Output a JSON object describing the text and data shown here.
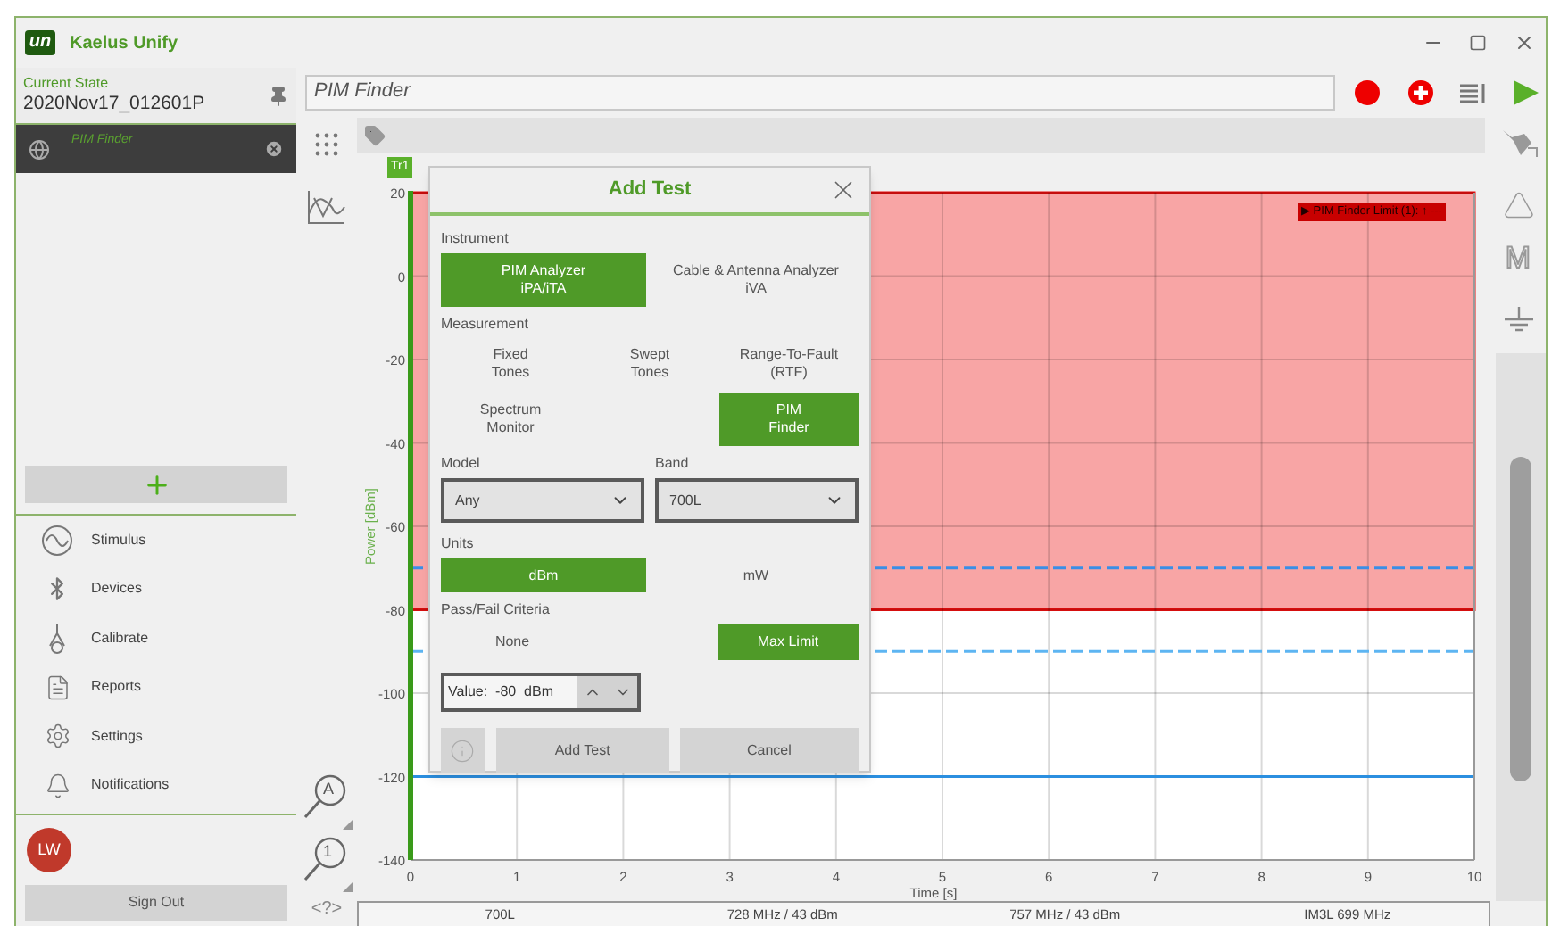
{
  "window": {
    "logo": "un",
    "title": "Kaelus Unify"
  },
  "sidebar": {
    "current_state_label": "Current State",
    "current_state": "2020Nov17_012601P",
    "tests": [
      {
        "label": "PIM Finder",
        "selected": true
      }
    ],
    "nav": [
      {
        "label": "Stimulus"
      },
      {
        "label": "Devices"
      },
      {
        "label": "Calibrate"
      },
      {
        "label": "Reports"
      },
      {
        "label": "Settings"
      },
      {
        "label": "Notifications"
      }
    ],
    "user": {
      "initials": "LW"
    },
    "sign_out": "Sign Out"
  },
  "toolbar": {
    "test_name": "PIM Finder"
  },
  "left_tools": {
    "zoom_auto": "A",
    "zoom_one": "1",
    "help": "<?>"
  },
  "right_toolbar": {
    "marker_text": "M"
  },
  "trace": {
    "label": "Tr1"
  },
  "chart_data": {
    "type": "line",
    "xlabel": "Time [s]",
    "ylabel": "Power [dBm]",
    "xlim": [
      0,
      10
    ],
    "ylim": [
      -140,
      20
    ],
    "xticks": [
      0,
      1,
      2,
      3,
      4,
      5,
      6,
      7,
      8,
      9,
      10
    ],
    "yticks": [
      20,
      0,
      -20,
      -40,
      -60,
      -80,
      -100,
      -120,
      -140
    ],
    "x": [
      0,
      10
    ],
    "series": [
      {
        "color": "#3a8ee6",
        "line_style": "dashed",
        "values": [
          -70,
          -70
        ]
      },
      {
        "color": "#5db5f2",
        "line_style": "dashed",
        "values": [
          -90,
          -90
        ]
      },
      {
        "color": "#2b8fe0",
        "line_style": "solid",
        "values": [
          -120,
          -120
        ]
      }
    ],
    "grid": true,
    "bands": [
      {
        "axis": "y",
        "from": -80,
        "to": 20,
        "color": "#f8a5a5",
        "label": "▶ PIM Finder Limit (1): ↑ ---"
      }
    ]
  },
  "status_bar": [
    "700L",
    "728 MHz / 43 dBm",
    "757 MHz / 43 dBm",
    "IM3L 699 MHz"
  ],
  "dialog": {
    "title": "Add Test",
    "instrument": {
      "label": "Instrument",
      "options": [
        {
          "label": "PIM Analyzer\niPA/iTA",
          "selected": true
        },
        {
          "label": "Cable & Antenna Analyzer\niVA",
          "selected": false
        }
      ]
    },
    "measurement": {
      "label": "Measurement",
      "rows": [
        [
          {
            "label": "Fixed\nTones",
            "selected": false
          },
          {
            "label": "Swept\nTones",
            "selected": false
          },
          {
            "label": "Range-To-Fault\n(RTF)",
            "selected": false
          }
        ],
        [
          {
            "label": "Spectrum\nMonitor",
            "selected": false
          },
          "",
          {
            "label": "PIM\nFinder",
            "selected": true
          }
        ]
      ]
    },
    "model": {
      "label": "Model",
      "value": "Any"
    },
    "band": {
      "label": "Band",
      "value": "700L"
    },
    "units": {
      "label": "Units",
      "options": [
        {
          "label": "dBm",
          "selected": true
        },
        {
          "label": "mW",
          "selected": false
        }
      ]
    },
    "pass_fail": {
      "label": "Pass/Fail Criteria",
      "options": [
        {
          "label": "None",
          "selected": false
        },
        {
          "label": "Max Limit",
          "selected": true
        }
      ]
    },
    "value_field": {
      "value": "Value:  -80  dBm"
    },
    "buttons": [
      "Add Test",
      "Cancel"
    ]
  }
}
